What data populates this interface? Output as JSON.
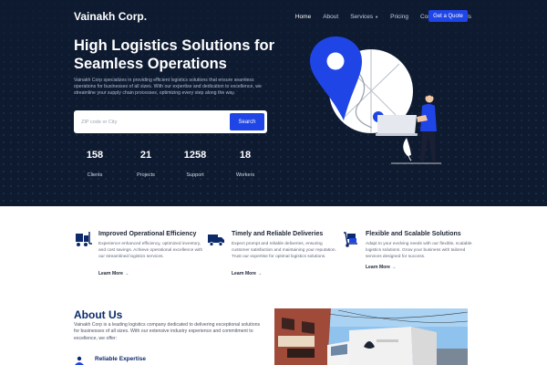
{
  "brand": "Vainakh Corp.",
  "nav": {
    "items": [
      "Home",
      "About",
      "Services",
      "Pricing",
      "Contact",
      "Brands"
    ],
    "cta": "Get a Quote"
  },
  "hero": {
    "title": "High Logistics Solutions for Seamless Operations",
    "description": "Vainakh Corp specializes in providing efficient logistics solutions that ensure seamless operations for businesses of all sizes. With our expertise and dedication to excellence, we streamline your supply chain processes, optimizing every step along the way.",
    "search": {
      "placeholder": "ZIP code or City",
      "button": "Search"
    },
    "stats": [
      {
        "value": "158",
        "label": "Clients"
      },
      {
        "value": "21",
        "label": "Projects"
      },
      {
        "value": "1258",
        "label": "Support"
      },
      {
        "value": "18",
        "label": "Workers"
      }
    ]
  },
  "features": [
    {
      "title": "Improved Operational Efficiency",
      "description": "Experience enhanced efficiency, optimized inventory, and cost savings. Achieve operational excellence with our streamlined logistics services.",
      "link": "Learn More"
    },
    {
      "title": "Timely and Reliable Deliveries",
      "description": "Expect prompt and reliable deliveries, ensuring customer satisfaction and maintaining your reputation. Trust our expertise for optimal logistics solutions.",
      "link": "Learn More"
    },
    {
      "title": "Flexible and Scalable Solutions",
      "description": "Adapt to your evolving needs with our flexible, scalable logistics solutions. Grow your business with tailored services designed for success.",
      "link": "Learn More"
    }
  ],
  "about": {
    "title": "About Us",
    "description": "Vainakh Corp is a leading logistics company dedicated to delivering exceptional solutions for businesses of all sizes. With our extensive industry experience and commitment to excellence, we offer:",
    "first_item": "Reliable Expertise"
  },
  "colors": {
    "hero_bg": "#0d1a30",
    "accent": "#1f45e6",
    "heading_dark": "#0d2a6b"
  }
}
